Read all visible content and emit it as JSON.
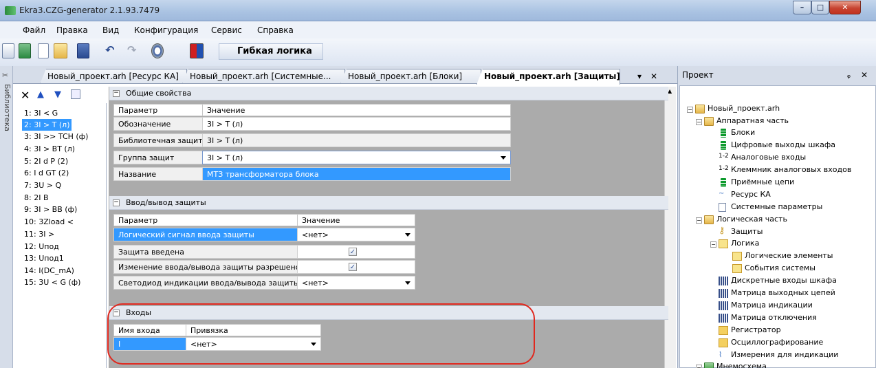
{
  "window": {
    "title": "Ekra3.CZG-generator 2.1.93.7479",
    "min": "–",
    "max": "□",
    "close": "✕"
  },
  "menu": [
    "Файл",
    "Правка",
    "Вид",
    "Конфигурация",
    "Сервис",
    "Справка"
  ],
  "toolbar": {
    "flex_logic_label": "Гибкая логика"
  },
  "sidebar_library_label": "Библиотека",
  "tabs": [
    {
      "label": "Новый_проект.arh [Ресурс КА]"
    },
    {
      "label": "Новый_проект.arh [Системные..."
    },
    {
      "label": "Новый_проект.arh [Блоки]"
    },
    {
      "label": "Новый_проект.arh [Защиты]",
      "active": true
    }
  ],
  "tab_controls": {
    "pin": "▾",
    "close": "✕"
  },
  "protections": [
    "1: 3I < G",
    "2: 3I > T (л)",
    "3: 3I >> TCH (ф)",
    "4: 3I > BT (л)",
    "5: 2I d P (2)",
    "6: I d GT (2)",
    "7: 3U > Q",
    "8: 2I B",
    "9: 3I > BB (ф)",
    "10: 3Zload <",
    "11: 3I >",
    "12: Uпод",
    "13: Uпод1",
    "14: I(DC_mA)",
    "15: 3U < G (ф)"
  ],
  "selected_protection": 1,
  "general": {
    "group_title": "Общие свойства",
    "col_param": "Параметр",
    "col_value": "Значение",
    "rows": [
      {
        "param": "Обозначение",
        "value": "3I > T (л)"
      },
      {
        "param": "Библиотечная защита",
        "value": "3I > T (л)"
      },
      {
        "param": "Группа защит",
        "value": "3I > T (л)"
      },
      {
        "param": "Название",
        "value": "МТЗ трансформатора блока"
      }
    ]
  },
  "io": {
    "group_title": "Ввод/вывод защиты",
    "col_param": "Параметр",
    "col_value": "Значение",
    "rows": [
      {
        "param": "Логический сигнал ввода защиты",
        "value": "<нет>"
      },
      {
        "param": "Защита введена",
        "value": "✓"
      },
      {
        "param": "Изменение ввода/вывода защиты разрешено",
        "value": "✓"
      },
      {
        "param": "Светодиод индикации ввода/вывода защиты",
        "value": "<нет>"
      }
    ]
  },
  "inputs": {
    "group_title": "Входы",
    "col_name": "Имя входа",
    "col_binding": "Привязка",
    "rows": [
      {
        "name": "I",
        "binding": "<нет>"
      }
    ]
  },
  "project_panel": {
    "title": "Проект",
    "pin": "ᵩ",
    "close": "✕",
    "tree": [
      {
        "label": "Новый_проект.arh"
      },
      {
        "label": "Аппаратная часть"
      },
      {
        "label": "Блоки"
      },
      {
        "label": "Цифровые выходы шкафа"
      },
      {
        "label": "Аналоговые входы",
        "prefix": "1-2"
      },
      {
        "label": "Клеммник аналоговых входов",
        "prefix": "1-2"
      },
      {
        "label": "Приёмные цепи"
      },
      {
        "label": "Ресурс КА"
      },
      {
        "label": "Системные параметры"
      },
      {
        "label": "Логическая часть"
      },
      {
        "label": "Защиты"
      },
      {
        "label": "Логика"
      },
      {
        "label": "Логические элементы"
      },
      {
        "label": "События системы"
      },
      {
        "label": "Дискретные входы шкафа"
      },
      {
        "label": "Матрица выходных цепей"
      },
      {
        "label": "Матрица индикации"
      },
      {
        "label": "Матрица отключения"
      },
      {
        "label": "Регистратор"
      },
      {
        "label": "Осциллографирование"
      },
      {
        "label": "Измерения для индикации"
      },
      {
        "label": "Мнемосхема"
      }
    ]
  }
}
